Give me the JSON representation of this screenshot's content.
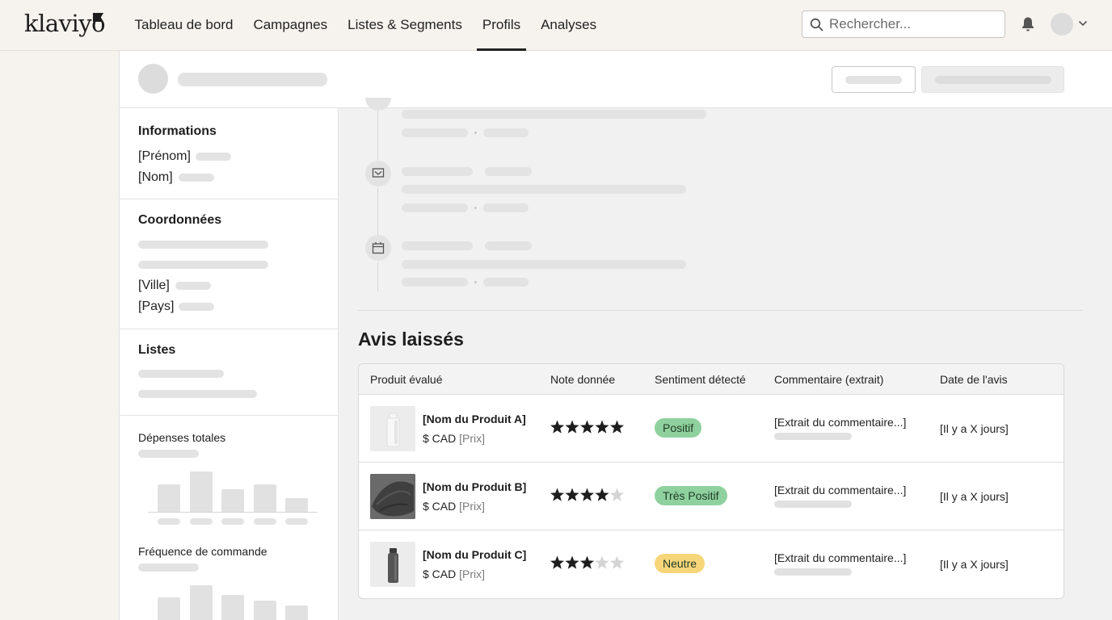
{
  "brand": {
    "logo_text": "klaviyo"
  },
  "nav": {
    "items": [
      {
        "label": "Tableau de bord",
        "active": false
      },
      {
        "label": "Campagnes",
        "active": false
      },
      {
        "label": "Listes & Segments",
        "active": false
      },
      {
        "label": "Profils",
        "active": true
      },
      {
        "label": "Analyses",
        "active": false
      }
    ]
  },
  "search": {
    "placeholder": "Rechercher...",
    "icon": "search-icon"
  },
  "header_icons": {
    "notifications": "bell-icon",
    "account_menu": "chevron-down-icon"
  },
  "sidebar": {
    "informations": {
      "title": "Informations",
      "first_name": "[Prénom]",
      "last_name": "[Nom]"
    },
    "coordonnees": {
      "title": "Coordonnées",
      "city": "[Ville]",
      "country": "[Pays]"
    },
    "listes": {
      "title": "Listes"
    },
    "depenses": {
      "title": "Dépenses totales"
    },
    "frequence": {
      "title": "Fréquence de commande"
    }
  },
  "timeline": {
    "icons": [
      "message-icon",
      "calendar-icon"
    ]
  },
  "reviews": {
    "title": "Avis laissés",
    "columns": [
      "Produit évalué",
      "Note donnée",
      "Sentiment détecté",
      "Commentaire (extrait)",
      "Date de l'avis"
    ],
    "rows": [
      {
        "product": "[Nom du Produit A]",
        "price_prefix": "$ CAD",
        "price_placeholder": "[Prix]",
        "rating": 5,
        "sentiment": "Positif",
        "sentiment_color": "#8fd19e",
        "comment": "[Extrait du commentaire...]",
        "date": "[Il y a X jours]",
        "image": "bottle-image"
      },
      {
        "product": "[Nom du Produit B]",
        "price_prefix": "$ CAD",
        "price_placeholder": "[Prix]",
        "rating": 4,
        "sentiment": "Très Positif",
        "sentiment_color": "#8fd19e",
        "comment": "[Extrait du commentaire...]",
        "date": "[Il y a X jours]",
        "image": "fabric-image"
      },
      {
        "product": "[Nom du Produit C]",
        "price_prefix": "$ CAD",
        "price_placeholder": "[Prix]",
        "rating": 3,
        "sentiment": "Neutre",
        "sentiment_color": "#f7d67a",
        "comment": "[Extrait du commentaire...]",
        "date": "[Il y a X jours]",
        "image": "flask-image"
      }
    ]
  },
  "colors": {
    "background": "#f6f3ee",
    "panel": "#f1f1f1",
    "star_filled": "#1d1d1d",
    "star_empty": "#d4d4d4"
  }
}
